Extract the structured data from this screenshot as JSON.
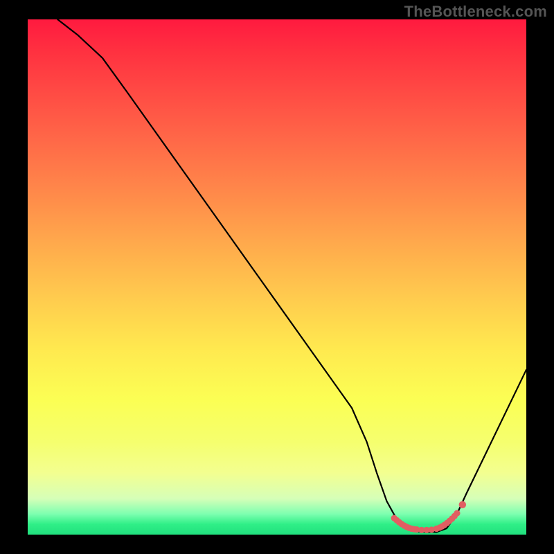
{
  "watermark": "TheBottleneck.com",
  "chart_data": {
    "type": "line",
    "title": "",
    "xlabel": "",
    "ylabel": "",
    "xlim": [
      0,
      100
    ],
    "ylim": [
      0,
      100
    ],
    "series": [
      {
        "name": "bottleneck-curve",
        "x": [
          6,
          10,
          15,
          20,
          25,
          30,
          35,
          40,
          45,
          50,
          55,
          60,
          65,
          68,
          70,
          72,
          74,
          76,
          78,
          80,
          82,
          84,
          86,
          88,
          92,
          96,
          100
        ],
        "y": [
          100,
          97,
          92.5,
          85.8,
          79,
          72.2,
          65.4,
          58.6,
          51.8,
          45,
          38.2,
          31.4,
          24.6,
          18,
          12,
          6.5,
          3.0,
          1.3,
          0.6,
          0.5,
          0.5,
          1.2,
          3.8,
          8,
          16,
          24,
          32
        ]
      },
      {
        "name": "optimal-zone-marker",
        "x": [
          73.5,
          74.0,
          74.5,
          75.0,
          75.5,
          76.0,
          76.5,
          77.0,
          77.5,
          78.0,
          79.0,
          80.0,
          81.0,
          82.0,
          82.6,
          83.1,
          83.6,
          84.1,
          84.6,
          85.1,
          85.6,
          86.1,
          87.2
        ],
        "y": [
          3.2,
          2.8,
          2.4,
          2.05,
          1.75,
          1.5,
          1.3,
          1.15,
          1.05,
          1.0,
          0.9,
          0.9,
          0.95,
          1.15,
          1.35,
          1.6,
          1.9,
          2.25,
          2.65,
          3.1,
          3.6,
          4.15,
          5.8
        ]
      }
    ],
    "colors": {
      "curve": "#000000",
      "marker": "#e15e62",
      "background_top": "#ff1a3f",
      "background_bottom": "#21e07e"
    }
  }
}
